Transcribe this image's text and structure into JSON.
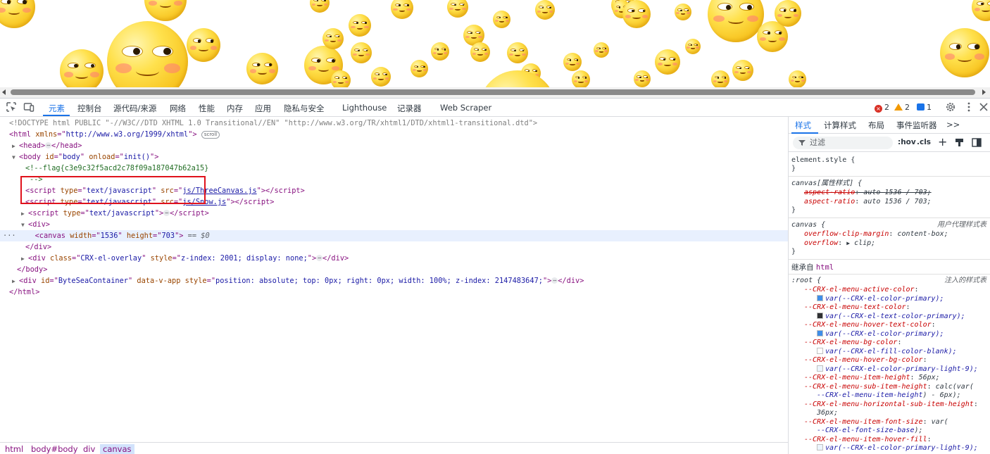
{
  "toolbar": {
    "tabs": [
      {
        "label": "元素",
        "active": true
      },
      {
        "label": "控制台"
      },
      {
        "label": "源代码/来源"
      },
      {
        "label": "网络"
      },
      {
        "label": "性能"
      },
      {
        "label": "内存"
      },
      {
        "label": "应用"
      },
      {
        "label": "隐私与安全"
      },
      {
        "label": "Lighthouse"
      },
      {
        "label": "记录器"
      },
      {
        "label": "Web Scraper"
      }
    ],
    "errors": "2",
    "warnings": "2",
    "messages": "1",
    "icons": [
      "inspect-element-icon",
      "device-toolbar-icon",
      "settings-gear-icon",
      "more-menu-icon",
      "close-icon"
    ]
  },
  "dom": {
    "doctype": "<!DOCTYPE html PUBLIC \"-//W3C//DTD XHTML 1.0 Transitional//EN\" \"http://www.w3.org/TR/xhtml1/DTD/xhtml1-transitional.dtd\">",
    "html_open": "html",
    "html_xmlns_attr": "xmlns",
    "html_xmlns_val": "http://www.w3.org/1999/xhtml",
    "scroll_badge": "scroll",
    "head": "head",
    "body_attr1": "id",
    "body_val1": "body",
    "body_attr2": "onload",
    "body_val2": "init()",
    "comment_line1": "<!--flag{c3e9c32f5acd2c78f09a187047b62a15}",
    "comment_line2": "-->",
    "script1_src": "js/ThreeCanvas.js",
    "script2_src": "js/Snow.js",
    "script_type": "text/javascript",
    "canvas_width": "1536",
    "canvas_height": "703",
    "selected_marker": "== $0",
    "overlay_class": "CRX-el-overlay",
    "overlay_style": "z-index: 2001; display: none;",
    "container_id": "ByteSeaContainer",
    "container_attr": "data-v-app",
    "container_style": "position: absolute; top: 0px; right: 0px; width: 100%; z-index: 2147483647;"
  },
  "breadcrumb": [
    "html",
    "body#body",
    "div",
    "canvas"
  ],
  "styles": {
    "tabs": [
      "样式",
      "计算样式",
      "布局",
      "事件监听器",
      ">>"
    ],
    "filter_placeholder": "过滤",
    "filter_buttons": [
      ":hov",
      ".cls"
    ],
    "element_style": "element.style {",
    "attr_rule_selector": "canvas[属性样式] {",
    "aspect_name": "aspect-ratio",
    "aspect_value": "auto 1536 / 703;",
    "canvas_rule_selector": "canvas {",
    "ua_label": "用户代理样式表",
    "overflow_margin_name": "overflow-clip-margin",
    "overflow_margin_value": "content-box;",
    "overflow_name": "overflow",
    "overflow_value": "clip;",
    "inherited_label": "继承自",
    "inherited_tag": "html",
    "root_selector": ":root {",
    "injected_label": "注入的样式表",
    "vars": [
      {
        "name": "--CRX-el-menu-active-color",
        "value": "var(--CRX-el-color-primary);",
        "swatch": "#3f8ee8"
      },
      {
        "name": "--CRX-el-menu-text-color",
        "value": "var(--CRX-el-text-color-primary);",
        "swatch": "#303133"
      },
      {
        "name": "--CRX-el-menu-hover-text-color",
        "value": "var(--CRX-el-color-primary);",
        "swatch": "#3f8ee8"
      },
      {
        "name": "--CRX-el-menu-bg-color",
        "value": "var(--CRX-el-fill-color-blank);",
        "swatch": "#ffffff"
      },
      {
        "name": "--CRX-el-menu-hover-bg-color",
        "value": "var(--CRX-el-color-primary-light-9);",
        "swatch": "#ecf5ff"
      }
    ],
    "item_height_name": "--CRX-el-menu-item-height",
    "item_height_value": "56px;",
    "sub_item_height_name": "--CRX-el-menu-sub-item-height",
    "sub_item_height_value": "calc(var(",
    "sub_item_height_cont": "--CRX-el-menu-item-height",
    "sub_item_height_tail": ") - 6px);",
    "horiz_sub_name": "--CRX-el-menu-horizontal-sub-item-height",
    "horiz_sub_value": "36px;",
    "font_size_name": "--CRX-el-menu-item-font-size",
    "font_size_value": "var(",
    "font_size_cont": "--CRX-el-font-size-base",
    "font_size_tail": ");",
    "hover_fill_name": "--CRX-el-menu-item-hover-fill",
    "hover_fill_value": "var(--CRX-el-color-primary-light-9);",
    "hover_fill_swatch": "#ecf5ff"
  }
}
